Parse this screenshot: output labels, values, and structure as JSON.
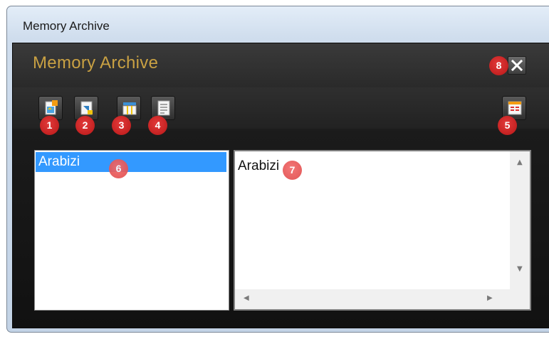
{
  "window": {
    "title": "Memory Archive"
  },
  "app": {
    "title": "Memory Archive"
  },
  "toolbar": {
    "buttons": [
      {
        "icon": "new-document-icon",
        "badge": "1"
      },
      {
        "icon": "import-document-icon",
        "badge": "2"
      },
      {
        "icon": "table-columns-icon",
        "badge": "3"
      },
      {
        "icon": "text-document-icon",
        "badge": "4"
      },
      {
        "icon": "view-list-icon",
        "badge": "5"
      }
    ]
  },
  "close": {
    "icon": "close-icon",
    "badge": "8"
  },
  "list": {
    "items": [
      {
        "label": "Arabizi"
      }
    ],
    "badge": "6"
  },
  "content": {
    "text": "Arabizi",
    "badge": "7"
  },
  "colors": {
    "accent_title": "#c9a143",
    "selection": "#3399ff",
    "badge_red": "#d22a2a"
  }
}
